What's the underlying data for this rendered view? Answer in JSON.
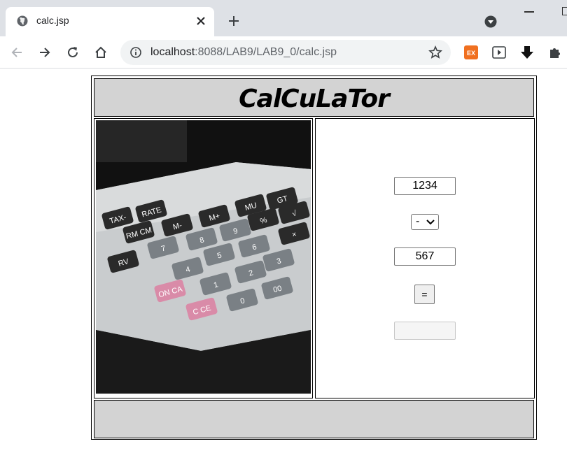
{
  "browser": {
    "tab_title": "calc.jsp",
    "url_host": "localhost",
    "url_rest": ":8088/LAB9/LAB9_0/calc.jsp",
    "ext_badge": "EX"
  },
  "page": {
    "title": "CalCuLaTor",
    "num1": "1234",
    "operator": "-",
    "num2": "567",
    "equals_label": "=",
    "result": ""
  },
  "calculator_keys": [
    "TAX-",
    "RATE",
    "RM CM",
    "M-",
    "M+",
    "MU",
    "GT",
    "%",
    "√",
    "×",
    "RV",
    "7",
    "8",
    "9",
    "5",
    "6",
    "4",
    "1",
    "2",
    "3",
    "0",
    "00",
    "ON CA",
    "C CE"
  ]
}
